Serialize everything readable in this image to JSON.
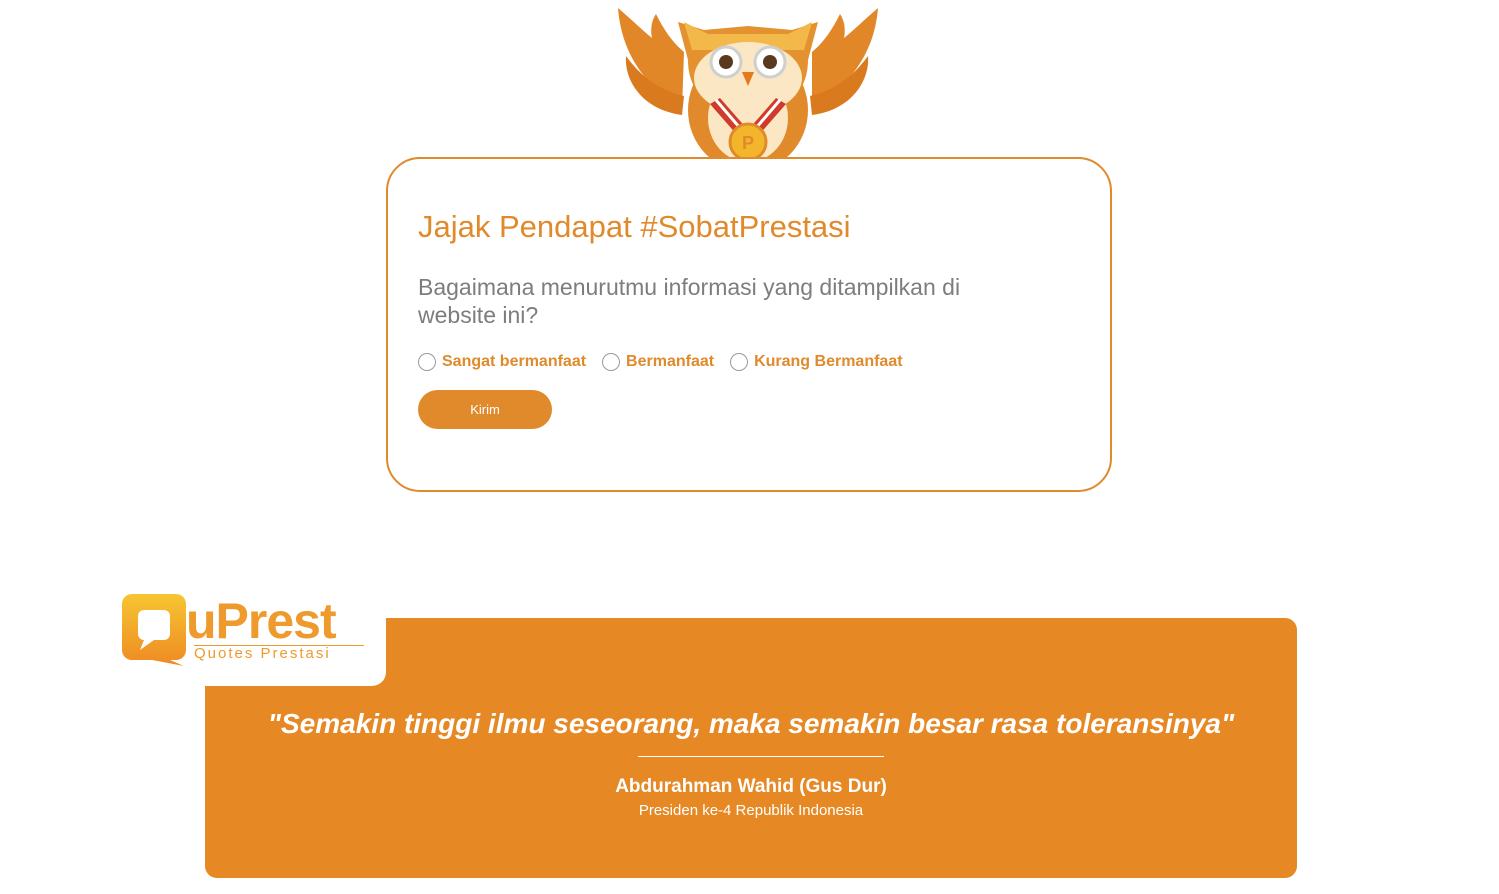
{
  "poll": {
    "title": "Jajak Pendapat #SobatPrestasi",
    "question": "Bagaimana menurutmu informasi yang ditampilkan di website ini?",
    "options": [
      {
        "label": "Sangat bermanfaat"
      },
      {
        "label": "Bermanfaat"
      },
      {
        "label": "Kurang Bermanfaat"
      }
    ],
    "submit_label": "Kirim"
  },
  "logo": {
    "wordmark": "uPrest",
    "tagline": "Quotes Prestasi"
  },
  "quote": {
    "text": "\"Semakin tinggi ilmu seseorang, maka semakin besar rasa toleransinya\"",
    "author": "Abdurahman Wahid (Gus Dur)",
    "role": "Presiden ke-4 Republik Indonesia"
  },
  "colors": {
    "accent": "#e08a2c",
    "banner": "#e68925",
    "question_text": "#7d7d7d"
  },
  "icons": {
    "mascot": "owl-mascot-icon",
    "logo_badge": "speech-bubble-q-icon"
  }
}
